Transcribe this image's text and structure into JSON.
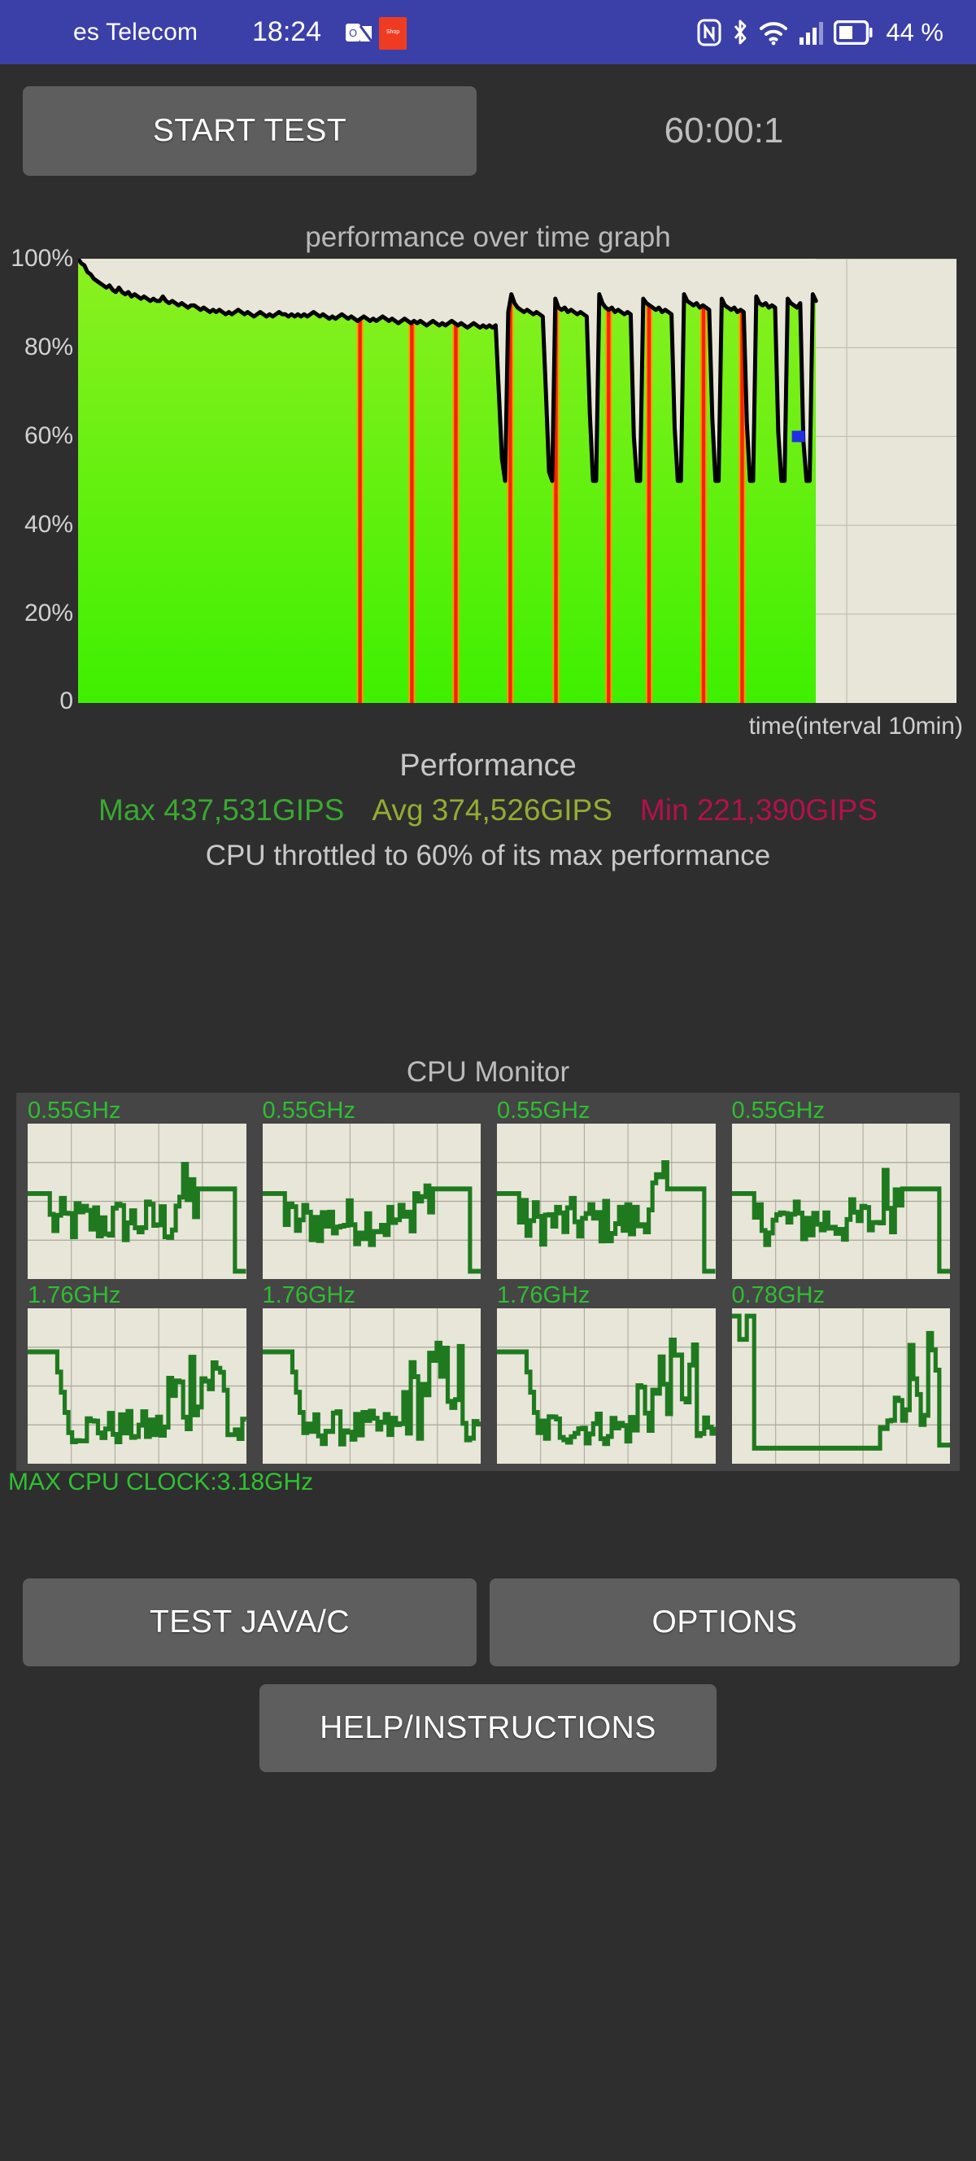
{
  "status_bar": {
    "carrier": "es Telecom",
    "clock": "18:24",
    "battery_percent": "44 %",
    "icons": [
      "outlook-icon",
      "shopping-app-icon",
      "nfc-icon",
      "bluetooth-icon",
      "wifi-icon",
      "signal-icon",
      "battery-icon"
    ],
    "background_color": "#3b40a8"
  },
  "toolbar": {
    "start_test_label": "START TEST",
    "timer": "60:00:1"
  },
  "graph": {
    "title": "performance over time graph",
    "x_axis_label": "time(interval 10min)",
    "y_ticks": [
      "100%",
      "80%",
      "60%",
      "40%",
      "20%",
      "0"
    ],
    "plot_bg": "#e8e6d8",
    "line_color": "#000000",
    "fill_color_top": "#8cf020",
    "fill_color_bottom": "#3ef000",
    "throttle_marker_color": "#f92100",
    "cursor_color": "#2030e0"
  },
  "performance": {
    "heading": "Performance",
    "max_label": "Max",
    "max_value": "437,531GIPS",
    "max_color": "#3aa832",
    "avg_label": "Avg",
    "avg_value": "374,526GIPS",
    "avg_color": "#93ac33",
    "min_label": "Min",
    "min_value": "221,390GIPS",
    "min_color": "#b3114a",
    "note": "CPU throttled to 60% of its max performance"
  },
  "cpu_monitor": {
    "title": "CPU Monitor",
    "max_clock_label": "MAX CPU CLOCK:3.18GHz",
    "cores": [
      {
        "freq": "0.55GHz"
      },
      {
        "freq": "0.55GHz"
      },
      {
        "freq": "0.55GHz"
      },
      {
        "freq": "0.55GHz"
      },
      {
        "freq": "1.76GHz"
      },
      {
        "freq": "1.76GHz"
      },
      {
        "freq": "1.76GHz"
      },
      {
        "freq": "0.78GHz"
      }
    ],
    "core_color": "#1f7a1f",
    "label_color": "#2fbd32"
  },
  "buttons": {
    "test_java_c": "TEST JAVA/C",
    "options": "OPTIONS",
    "help_instructions": "HELP/INSTRUCTIONS"
  },
  "chart_data": {
    "type": "area",
    "title": "performance over time graph",
    "xlabel": "time(interval 10min)",
    "ylabel": "",
    "ylim": [
      0,
      100
    ],
    "grid": true,
    "x_gridlines": 7,
    "series": [
      {
        "name": "performance",
        "units": "% of max performance",
        "values": [
          100,
          99,
          98.5,
          97,
          96.5,
          95.5,
          95,
          94.5,
          94,
          93.5,
          94,
          93,
          92.5,
          93.5,
          92.5,
          92,
          92.5,
          91.5,
          92,
          91.5,
          91,
          91.5,
          91,
          90.5,
          91,
          90.5,
          90.5,
          91.5,
          90.5,
          90,
          90.5,
          90,
          89.5,
          90,
          89.5,
          89,
          89.5,
          89.5,
          89,
          88.5,
          89,
          88.5,
          88,
          88.5,
          88,
          88.5,
          88,
          87.5,
          88,
          87.5,
          88,
          88.5,
          88,
          87.5,
          88,
          87.5,
          87,
          87.5,
          88,
          87.5,
          87,
          87.5,
          87,
          87.5,
          88,
          87.5,
          87.5,
          87,
          87.5,
          87,
          87.5,
          87,
          87.5,
          87,
          87.5,
          88,
          87.5,
          87,
          87.5,
          87,
          86.5,
          87,
          86.5,
          87,
          87.5,
          87,
          86.5,
          87,
          86.5,
          86,
          86.5,
          87,
          86.5,
          86,
          86.5,
          86,
          86.5,
          87,
          86.5,
          86,
          86.5,
          86,
          85.5,
          86,
          86.5,
          86,
          85.5,
          86,
          85.5,
          86,
          85.5,
          85,
          85.5,
          86,
          85.5,
          85,
          85.5,
          85,
          85.5,
          86,
          85.5,
          85,
          85.5,
          85,
          84.5,
          85,
          85.5,
          85,
          84.5,
          85,
          84.5,
          85,
          84.5,
          85,
          70,
          55,
          50,
          88,
          92,
          90,
          89,
          88.5,
          88,
          88.5,
          88,
          87.5,
          88,
          87.5,
          87,
          70,
          52,
          50,
          91,
          89,
          88.5,
          89,
          88,
          88.5,
          88,
          87.5,
          88,
          87.5,
          87,
          65,
          50,
          50,
          92,
          90,
          89,
          88.5,
          89,
          88,
          88.5,
          88,
          87.5,
          88,
          87.5,
          60,
          50,
          50,
          91,
          90,
          89.5,
          89,
          88.5,
          89,
          88,
          88.5,
          88,
          87.5,
          62,
          50,
          50,
          92,
          90.5,
          90,
          89.5,
          90,
          89,
          89.5,
          89,
          88.5,
          64,
          50,
          50,
          91,
          89.5,
          89,
          88.5,
          89,
          88,
          88.5,
          88,
          63,
          50,
          50,
          91.5,
          90,
          89.5,
          90,
          89,
          89.5,
          89,
          61,
          50,
          50,
          91,
          90,
          89.5,
          89,
          90,
          59,
          50,
          50,
          92,
          90.5
        ]
      }
    ],
    "throttle_events_percent_of_width": [
      32.1,
      38.0,
      43.0,
      49.2,
      54.4,
      60.4,
      65.0,
      71.2,
      75.6
    ],
    "data_extent_percent_of_width": 84,
    "cursor_point": {
      "x_percent": 82.0,
      "y_percent": 60
    }
  }
}
